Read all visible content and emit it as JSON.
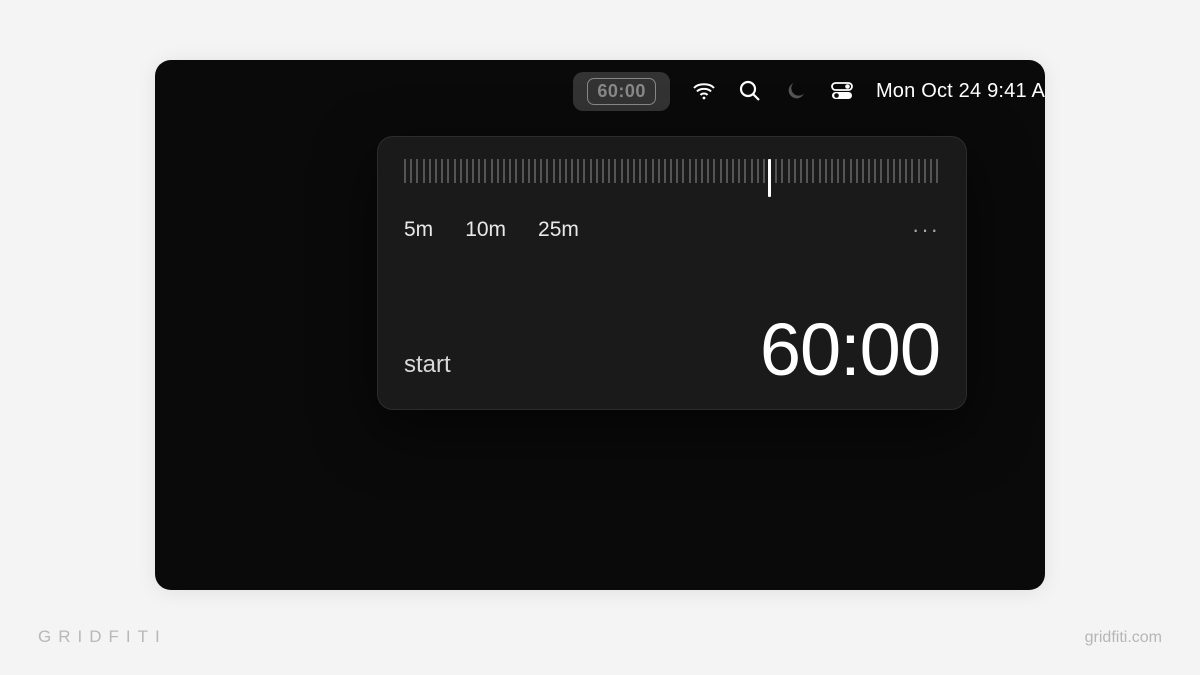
{
  "menubar": {
    "timer_badge": "60:00",
    "clock": "Mon Oct 24  9:41 A",
    "icons": {
      "wifi": "wifi-icon",
      "search": "search-icon",
      "dnd": "moon-icon",
      "control_center": "control-center-icon"
    }
  },
  "popover": {
    "ruler": {
      "tick_count": 88,
      "marker_position_pct": 68
    },
    "presets": [
      "5m",
      "10m",
      "25m"
    ],
    "more_label": "···",
    "start_label": "start",
    "time_display": "60:00"
  },
  "watermark": {
    "brand": "GRIDFITI",
    "url": "gridfiti.com"
  }
}
